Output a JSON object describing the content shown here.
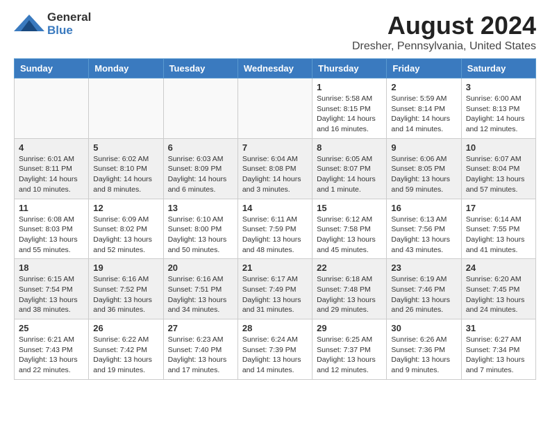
{
  "header": {
    "logo_general": "General",
    "logo_blue": "Blue",
    "title": "August 2024",
    "subtitle": "Dresher, Pennsylvania, United States"
  },
  "calendar": {
    "days_of_week": [
      "Sunday",
      "Monday",
      "Tuesday",
      "Wednesday",
      "Thursday",
      "Friday",
      "Saturday"
    ],
    "weeks": [
      [
        {
          "day": "",
          "info": ""
        },
        {
          "day": "",
          "info": ""
        },
        {
          "day": "",
          "info": ""
        },
        {
          "day": "",
          "info": ""
        },
        {
          "day": "1",
          "info": "Sunrise: 5:58 AM\nSunset: 8:15 PM\nDaylight: 14 hours\nand 16 minutes."
        },
        {
          "day": "2",
          "info": "Sunrise: 5:59 AM\nSunset: 8:14 PM\nDaylight: 14 hours\nand 14 minutes."
        },
        {
          "day": "3",
          "info": "Sunrise: 6:00 AM\nSunset: 8:13 PM\nDaylight: 14 hours\nand 12 minutes."
        }
      ],
      [
        {
          "day": "4",
          "info": "Sunrise: 6:01 AM\nSunset: 8:11 PM\nDaylight: 14 hours\nand 10 minutes."
        },
        {
          "day": "5",
          "info": "Sunrise: 6:02 AM\nSunset: 8:10 PM\nDaylight: 14 hours\nand 8 minutes."
        },
        {
          "day": "6",
          "info": "Sunrise: 6:03 AM\nSunset: 8:09 PM\nDaylight: 14 hours\nand 6 minutes."
        },
        {
          "day": "7",
          "info": "Sunrise: 6:04 AM\nSunset: 8:08 PM\nDaylight: 14 hours\nand 3 minutes."
        },
        {
          "day": "8",
          "info": "Sunrise: 6:05 AM\nSunset: 8:07 PM\nDaylight: 14 hours\nand 1 minute."
        },
        {
          "day": "9",
          "info": "Sunrise: 6:06 AM\nSunset: 8:05 PM\nDaylight: 13 hours\nand 59 minutes."
        },
        {
          "day": "10",
          "info": "Sunrise: 6:07 AM\nSunset: 8:04 PM\nDaylight: 13 hours\nand 57 minutes."
        }
      ],
      [
        {
          "day": "11",
          "info": "Sunrise: 6:08 AM\nSunset: 8:03 PM\nDaylight: 13 hours\nand 55 minutes."
        },
        {
          "day": "12",
          "info": "Sunrise: 6:09 AM\nSunset: 8:02 PM\nDaylight: 13 hours\nand 52 minutes."
        },
        {
          "day": "13",
          "info": "Sunrise: 6:10 AM\nSunset: 8:00 PM\nDaylight: 13 hours\nand 50 minutes."
        },
        {
          "day": "14",
          "info": "Sunrise: 6:11 AM\nSunset: 7:59 PM\nDaylight: 13 hours\nand 48 minutes."
        },
        {
          "day": "15",
          "info": "Sunrise: 6:12 AM\nSunset: 7:58 PM\nDaylight: 13 hours\nand 45 minutes."
        },
        {
          "day": "16",
          "info": "Sunrise: 6:13 AM\nSunset: 7:56 PM\nDaylight: 13 hours\nand 43 minutes."
        },
        {
          "day": "17",
          "info": "Sunrise: 6:14 AM\nSunset: 7:55 PM\nDaylight: 13 hours\nand 41 minutes."
        }
      ],
      [
        {
          "day": "18",
          "info": "Sunrise: 6:15 AM\nSunset: 7:54 PM\nDaylight: 13 hours\nand 38 minutes."
        },
        {
          "day": "19",
          "info": "Sunrise: 6:16 AM\nSunset: 7:52 PM\nDaylight: 13 hours\nand 36 minutes."
        },
        {
          "day": "20",
          "info": "Sunrise: 6:16 AM\nSunset: 7:51 PM\nDaylight: 13 hours\nand 34 minutes."
        },
        {
          "day": "21",
          "info": "Sunrise: 6:17 AM\nSunset: 7:49 PM\nDaylight: 13 hours\nand 31 minutes."
        },
        {
          "day": "22",
          "info": "Sunrise: 6:18 AM\nSunset: 7:48 PM\nDaylight: 13 hours\nand 29 minutes."
        },
        {
          "day": "23",
          "info": "Sunrise: 6:19 AM\nSunset: 7:46 PM\nDaylight: 13 hours\nand 26 minutes."
        },
        {
          "day": "24",
          "info": "Sunrise: 6:20 AM\nSunset: 7:45 PM\nDaylight: 13 hours\nand 24 minutes."
        }
      ],
      [
        {
          "day": "25",
          "info": "Sunrise: 6:21 AM\nSunset: 7:43 PM\nDaylight: 13 hours\nand 22 minutes."
        },
        {
          "day": "26",
          "info": "Sunrise: 6:22 AM\nSunset: 7:42 PM\nDaylight: 13 hours\nand 19 minutes."
        },
        {
          "day": "27",
          "info": "Sunrise: 6:23 AM\nSunset: 7:40 PM\nDaylight: 13 hours\nand 17 minutes."
        },
        {
          "day": "28",
          "info": "Sunrise: 6:24 AM\nSunset: 7:39 PM\nDaylight: 13 hours\nand 14 minutes."
        },
        {
          "day": "29",
          "info": "Sunrise: 6:25 AM\nSunset: 7:37 PM\nDaylight: 13 hours\nand 12 minutes."
        },
        {
          "day": "30",
          "info": "Sunrise: 6:26 AM\nSunset: 7:36 PM\nDaylight: 13 hours\nand 9 minutes."
        },
        {
          "day": "31",
          "info": "Sunrise: 6:27 AM\nSunset: 7:34 PM\nDaylight: 13 hours\nand 7 minutes."
        }
      ]
    ]
  }
}
